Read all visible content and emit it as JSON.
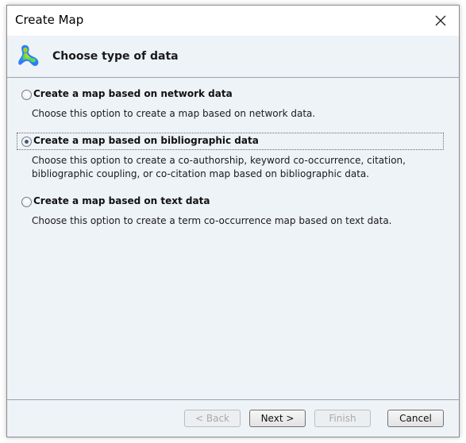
{
  "window": {
    "title": "Create Map"
  },
  "header": {
    "title": "Choose type of data",
    "icon": "density-map-icon"
  },
  "options": [
    {
      "label": "Create a map based on network data",
      "description": "Choose this option to create a map based on network data.",
      "selected": false
    },
    {
      "label": "Create a map based on bibliographic data",
      "description": "Choose this option to create a co-authorship, keyword co-occurrence, citation, bibliographic coupling, or co-citation map based on bibliographic data.",
      "selected": true
    },
    {
      "label": "Create a map based on text data",
      "description": "Choose this option to create a term co-occurrence map based on text data.",
      "selected": false
    }
  ],
  "buttons": {
    "back": "< Back",
    "next": "Next >",
    "finish": "Finish",
    "cancel": "Cancel"
  }
}
